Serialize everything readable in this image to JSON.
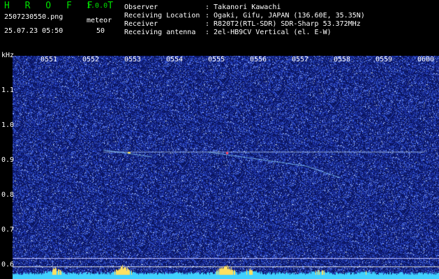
{
  "app": {
    "logo": "H R O F F T",
    "version": "1.0.0"
  },
  "file": {
    "name": "2507230550.png",
    "datetime": "25.07.23 05:50"
  },
  "meteor": {
    "label": "meteor",
    "count": "50"
  },
  "info": [
    {
      "key": "Observer",
      "value": ": Takanori Kawachi"
    },
    {
      "key": "Receiving Location",
      "value": ": Ogaki, Gifu, JAPAN (136.60E, 35.35N)"
    },
    {
      "key": "Receiver",
      "value": ": R820T2(RTL-SDR) SDR-Sharp 53.372MHz"
    },
    {
      "key": "Receiving antenna",
      "value": ": 2el-HB9CV Vertical (el. E-W)"
    }
  ],
  "axis": {
    "unit": "kHz",
    "times": [
      "0551",
      "0552",
      "0553",
      "0554",
      "0555",
      "0556",
      "0557",
      "0558",
      "0559",
      "0600"
    ],
    "freqs": [
      "1.1",
      "1.0",
      "0.9",
      "0.8",
      "0.7",
      "0.6"
    ]
  },
  "colors": {
    "background": "#0a1560",
    "noise": "#4a6cff",
    "carrier": "#c8e8ff",
    "bottom": "#40d0ff"
  }
}
